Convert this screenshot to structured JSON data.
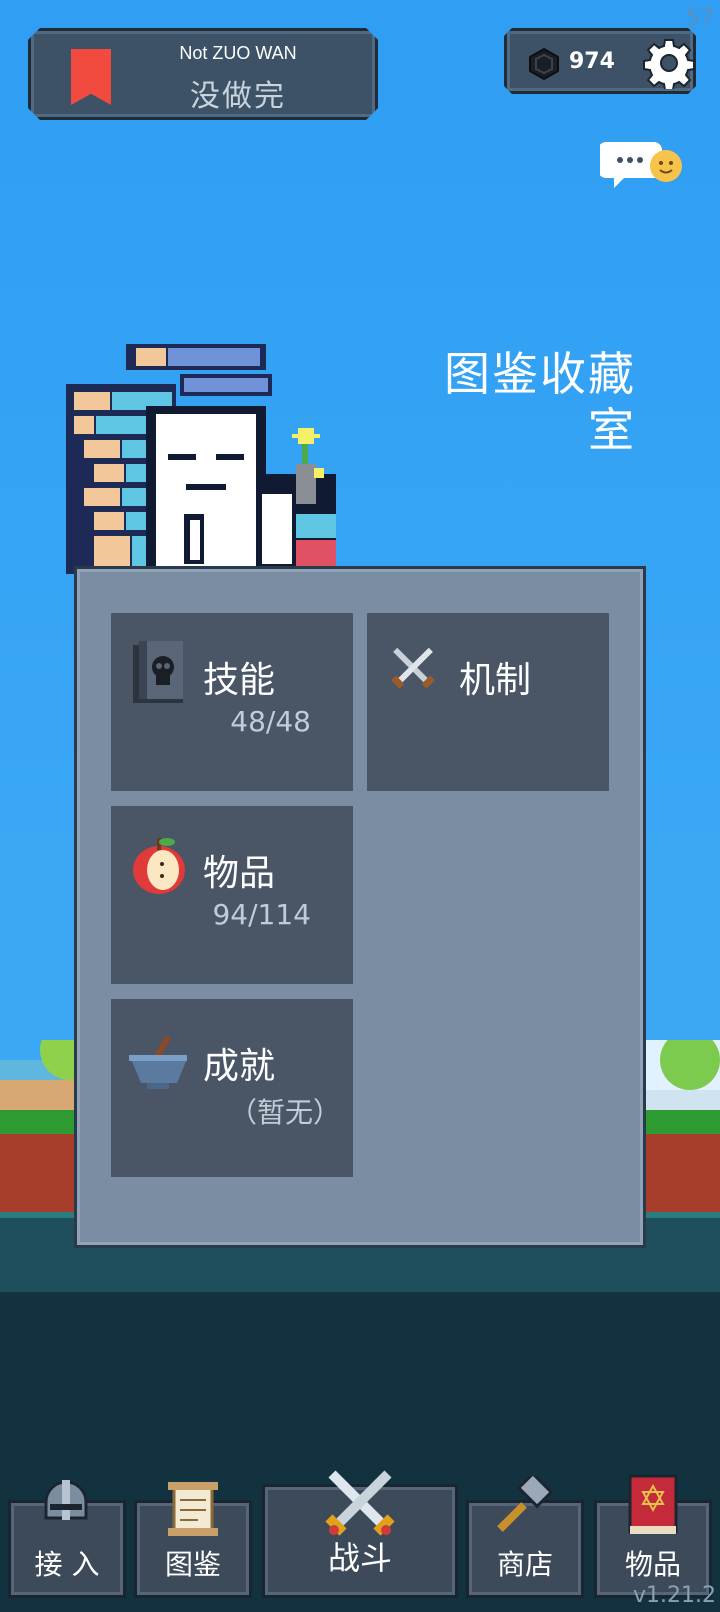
{
  "header": {
    "title_en": "Not ZUO WAN",
    "title_cn": "没做完"
  },
  "currency": {
    "gem_count": "974"
  },
  "fps": "57",
  "scene": {
    "title_line1": "图鉴收藏",
    "title_line2": "室"
  },
  "cards": {
    "skills": {
      "label": "技能",
      "count": "48/48"
    },
    "mechanics": {
      "label": "机制"
    },
    "items": {
      "label": "物品",
      "count": "94/114"
    },
    "achievements": {
      "label": "成就",
      "count": "（暂无）"
    }
  },
  "nav": {
    "connect": "接 入",
    "codex": "图鉴",
    "battle": "战斗",
    "shop": "商店",
    "items": "物品"
  },
  "version": "v1.21.2",
  "colors": {
    "sky": "#3aa8f5",
    "panel": "#7a8da3",
    "card": "#4a5566",
    "bookmark": "#f04b3e"
  }
}
